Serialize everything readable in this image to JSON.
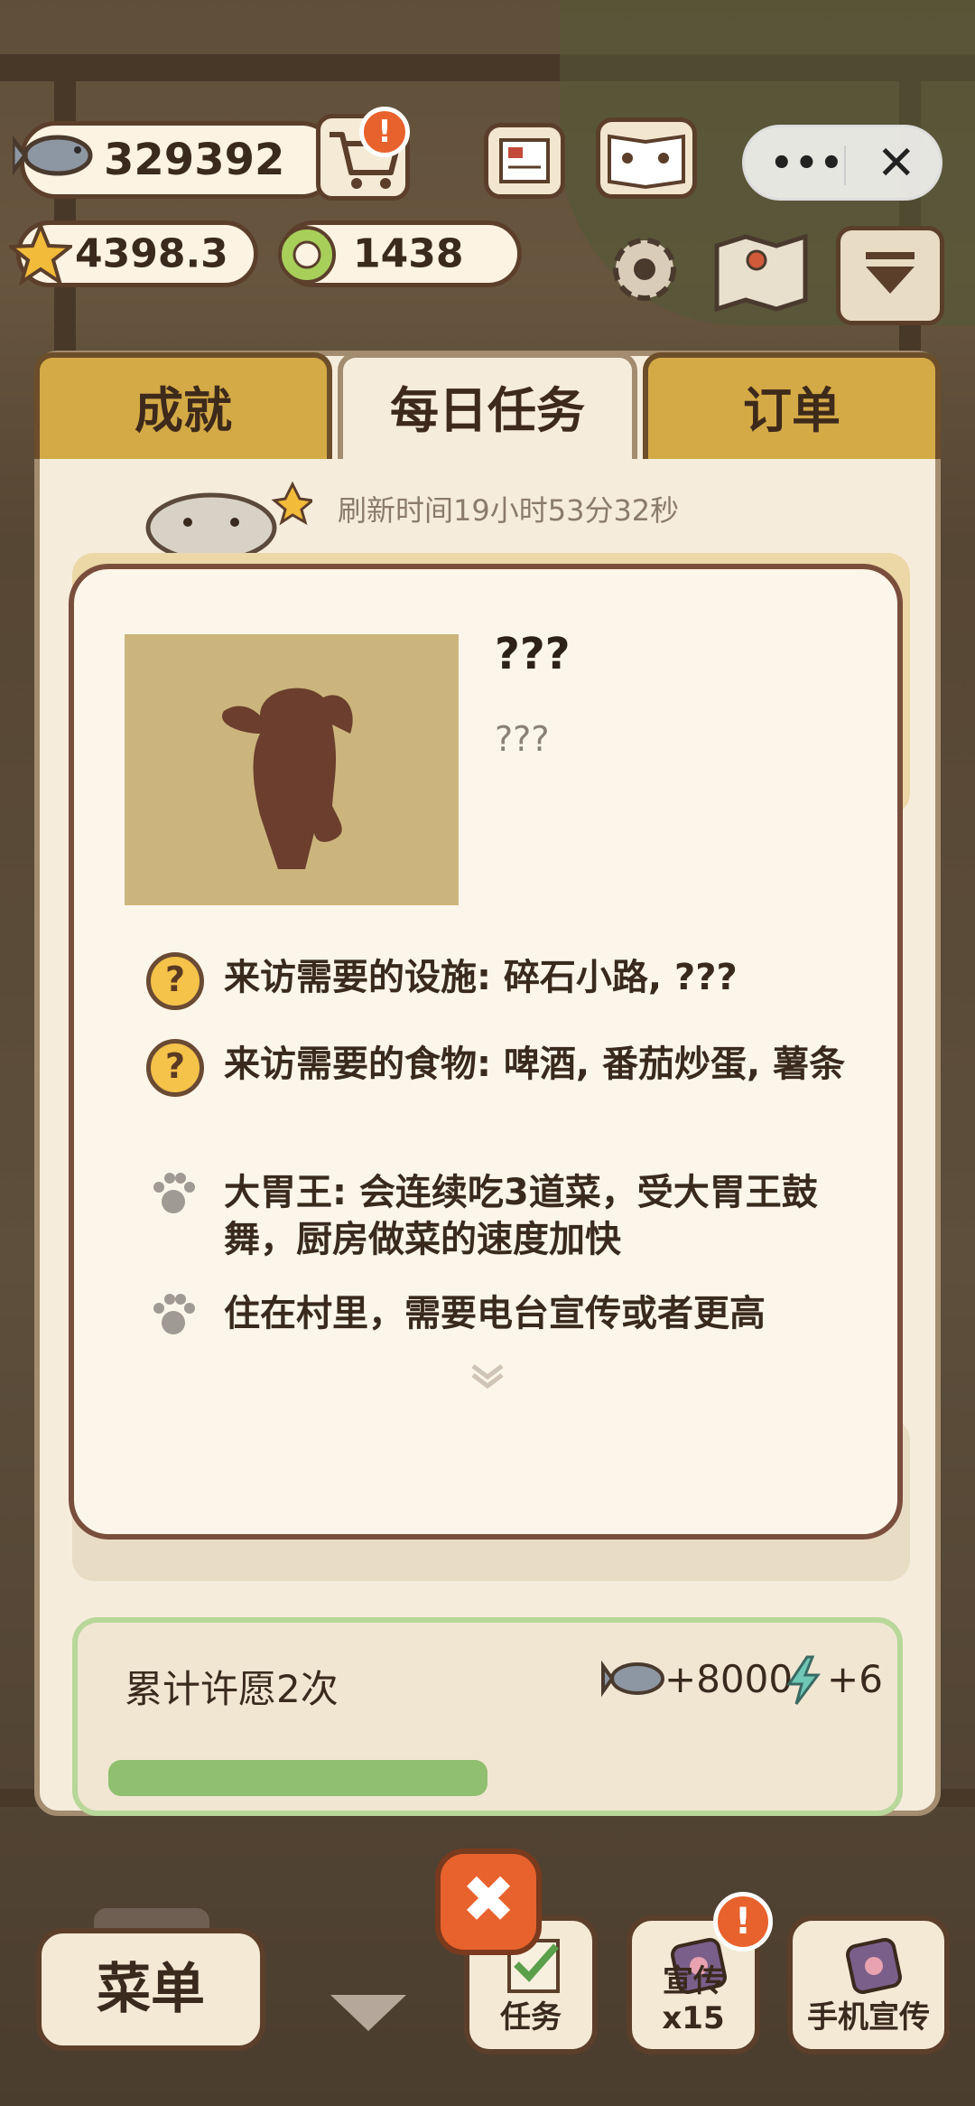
{
  "hud": {
    "fish_count": "329392",
    "star_count": "4398.3",
    "ring_count": "1438",
    "alert_mark": "!"
  },
  "capsule": {
    "more": "•••",
    "close": "✕"
  },
  "tabs": [
    {
      "label": "成就"
    },
    {
      "label": "每日任务"
    },
    {
      "label": "订单"
    }
  ],
  "refresh_text": "刷新时间19小时53分32秒",
  "popup": {
    "name": "???",
    "description": "???",
    "lines": [
      {
        "icon": "question-icon",
        "text": "来访需要的设施: 碎石小路, ???"
      },
      {
        "icon": "question-icon",
        "text": "来访需要的食物: 啤酒, 番茄炒蛋, 薯条"
      },
      {
        "icon": "paw-icon",
        "text": "大胃王: 会连续吃3道菜，受大胃王鼓舞，厨房做菜的速度加快"
      },
      {
        "icon": "paw-icon",
        "text": "住在村里，需要电台宣传或者更高"
      }
    ],
    "qmark": "?"
  },
  "progress_card": {
    "title": "累计许愿2次",
    "fish_reward": "+8000",
    "energy_reward": "+6"
  },
  "bottom": {
    "menu": "菜单",
    "task": "任务",
    "promo": "宣传x15",
    "phone_promo": "手机宣传",
    "close": "✖"
  },
  "colors": {
    "tab_inactive": "#d4aa46",
    "panel_bg": "#f6ecdc",
    "popup_border": "#7a4e3c",
    "accent_orange": "#e8622d",
    "portrait_bg": "#cbb57c",
    "silhouette": "#6b3e2e"
  }
}
